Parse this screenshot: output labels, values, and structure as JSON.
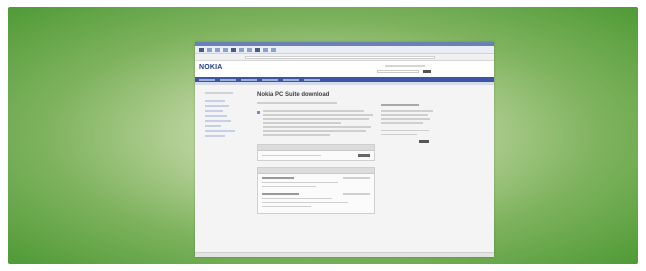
{
  "header": {
    "logo": "NOKIA"
  },
  "main": {
    "title": "Nokia PC Suite download"
  }
}
